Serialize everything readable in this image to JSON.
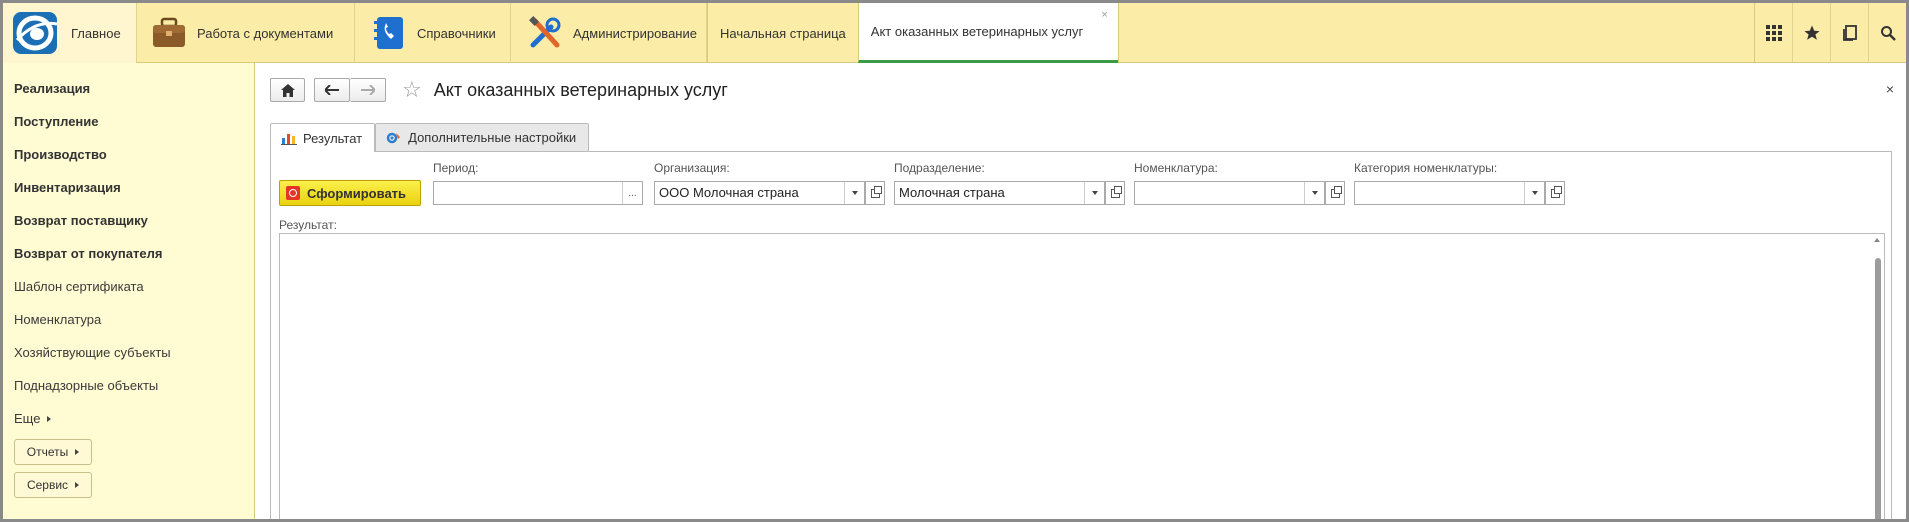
{
  "topbar": {
    "sections": [
      {
        "label": "Главное",
        "icon": "onec-logo-icon"
      },
      {
        "label": "Работа с документами",
        "icon": "briefcase-icon"
      },
      {
        "label": "Справочники",
        "icon": "phone-book-icon"
      },
      {
        "label": "Администрирование",
        "icon": "tools-icon"
      }
    ],
    "tabs": [
      {
        "label": "Начальная страница"
      },
      {
        "label": "Акт оказанных ветеринарных услуг",
        "close": "×"
      }
    ],
    "icons": [
      "apps-grid-icon",
      "favorites-star-icon",
      "history-icon",
      "search-icon"
    ]
  },
  "sidebar": {
    "items": [
      {
        "label": "Реализация",
        "bold": true
      },
      {
        "label": "Поступление",
        "bold": true
      },
      {
        "label": "Производство",
        "bold": true
      },
      {
        "label": "Инвентаризация",
        "bold": true
      },
      {
        "label": "Возврат поставщику",
        "bold": true
      },
      {
        "label": "Возврат от покупателя",
        "bold": true
      },
      {
        "label": "Шаблон сертификата",
        "bold": false
      },
      {
        "label": "Номенклатура",
        "bold": false
      },
      {
        "label": "Хозяйствующие субъекты",
        "bold": false
      },
      {
        "label": "Поднадзорные объекты",
        "bold": false
      }
    ],
    "more": "Еще",
    "reports_btn": "Отчеты",
    "service_btn": "Сервис"
  },
  "form": {
    "title": "Акт оказанных ветеринарных услуг",
    "close": "×",
    "tabs": [
      {
        "label": "Результат"
      },
      {
        "label": "Дополнительные настройки"
      }
    ],
    "generate_btn": "Сформировать",
    "fields": {
      "period": {
        "label": "Период:",
        "value": "",
        "dots": "..."
      },
      "organization": {
        "label": "Организация:",
        "value": "ООО Молочная страна"
      },
      "department": {
        "label": "Подразделение:",
        "value": "Молочная страна"
      },
      "nomenclature": {
        "label": "Номенклатура:",
        "value": ""
      },
      "category": {
        "label": "Категория номенклатуры:",
        "value": ""
      }
    },
    "result_label": "Результат:"
  },
  "colors": {
    "topbar": "#fbeda7",
    "sidebar": "#fffbd2",
    "active_tab_underline": "#3c9b4a",
    "generate_button": "#f4e22c"
  }
}
